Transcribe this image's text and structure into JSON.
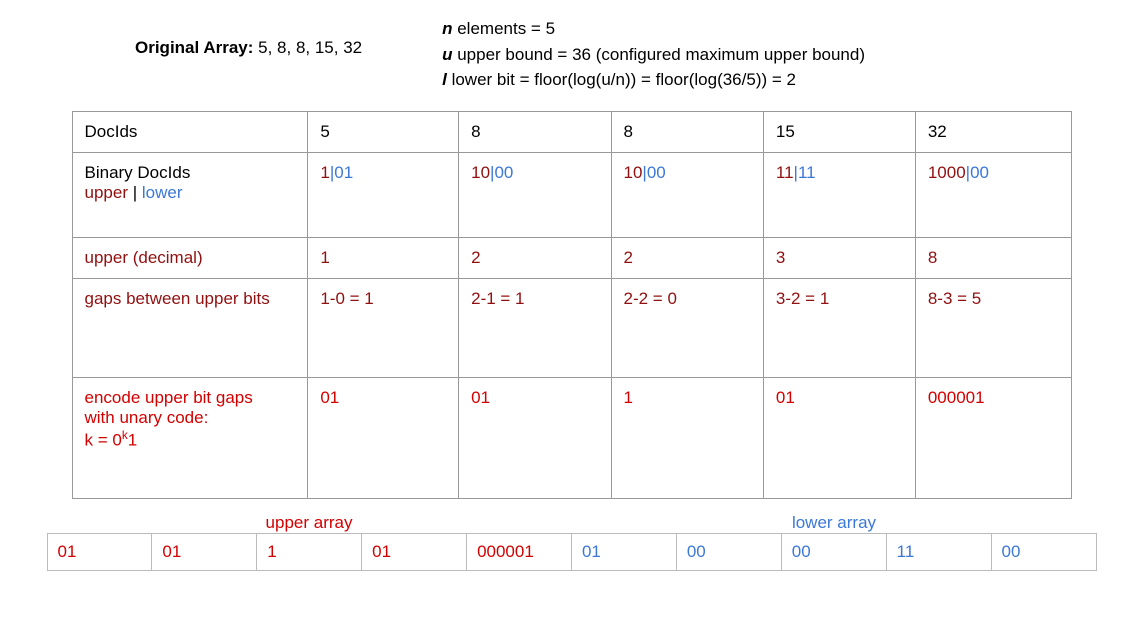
{
  "header": {
    "orig_label": "Original Array:",
    "orig_values": "5, 8, 8, 15, 32",
    "n_line": " elements = 5",
    "n_var": "n",
    "u_line": " upper bound = 36 (configured maximum upper bound)",
    "u_var": "u",
    "l_line": " lower bit = floor(log(u/n)) = floor(log(36/5)) = 2",
    "l_var": "l"
  },
  "table": {
    "rows": {
      "docids": {
        "label": "DocIds",
        "vals": [
          "5",
          "8",
          "8",
          "15",
          "32"
        ]
      },
      "binary": {
        "label_main": "Binary DocIds",
        "label_upper": "upper",
        "label_sep": " | ",
        "label_lower": "lower",
        "vals": [
          {
            "u": "1",
            "l": "01"
          },
          {
            "u": "10",
            "l": "00"
          },
          {
            "u": "10",
            "l": "00"
          },
          {
            "u": "11",
            "l": "11"
          },
          {
            "u": "1000",
            "l": "00"
          }
        ]
      },
      "upper_dec": {
        "label": "upper (decimal)",
        "vals": [
          "1",
          "2",
          "2",
          "3",
          "8"
        ]
      },
      "gaps": {
        "label": "gaps between upper bits",
        "vals": [
          "1-0 = 1",
          "2-1 = 1",
          "2-2 = 0",
          "3-2 = 1",
          "8-3 = 5"
        ]
      },
      "encode": {
        "label_l1": "encode upper bit gaps",
        "label_l2": "with unary code:",
        "label_l3_pre": "k = 0",
        "label_l3_sup": "k",
        "label_l3_post": "1",
        "vals": [
          "01",
          "01",
          "1",
          "01",
          "000001"
        ]
      }
    }
  },
  "arrays": {
    "upper_label": "upper array",
    "lower_label": "lower array",
    "upper": [
      "01",
      "01",
      "1",
      "01",
      "000001"
    ],
    "lower": [
      "01",
      "00",
      "00",
      "11",
      "00"
    ]
  }
}
